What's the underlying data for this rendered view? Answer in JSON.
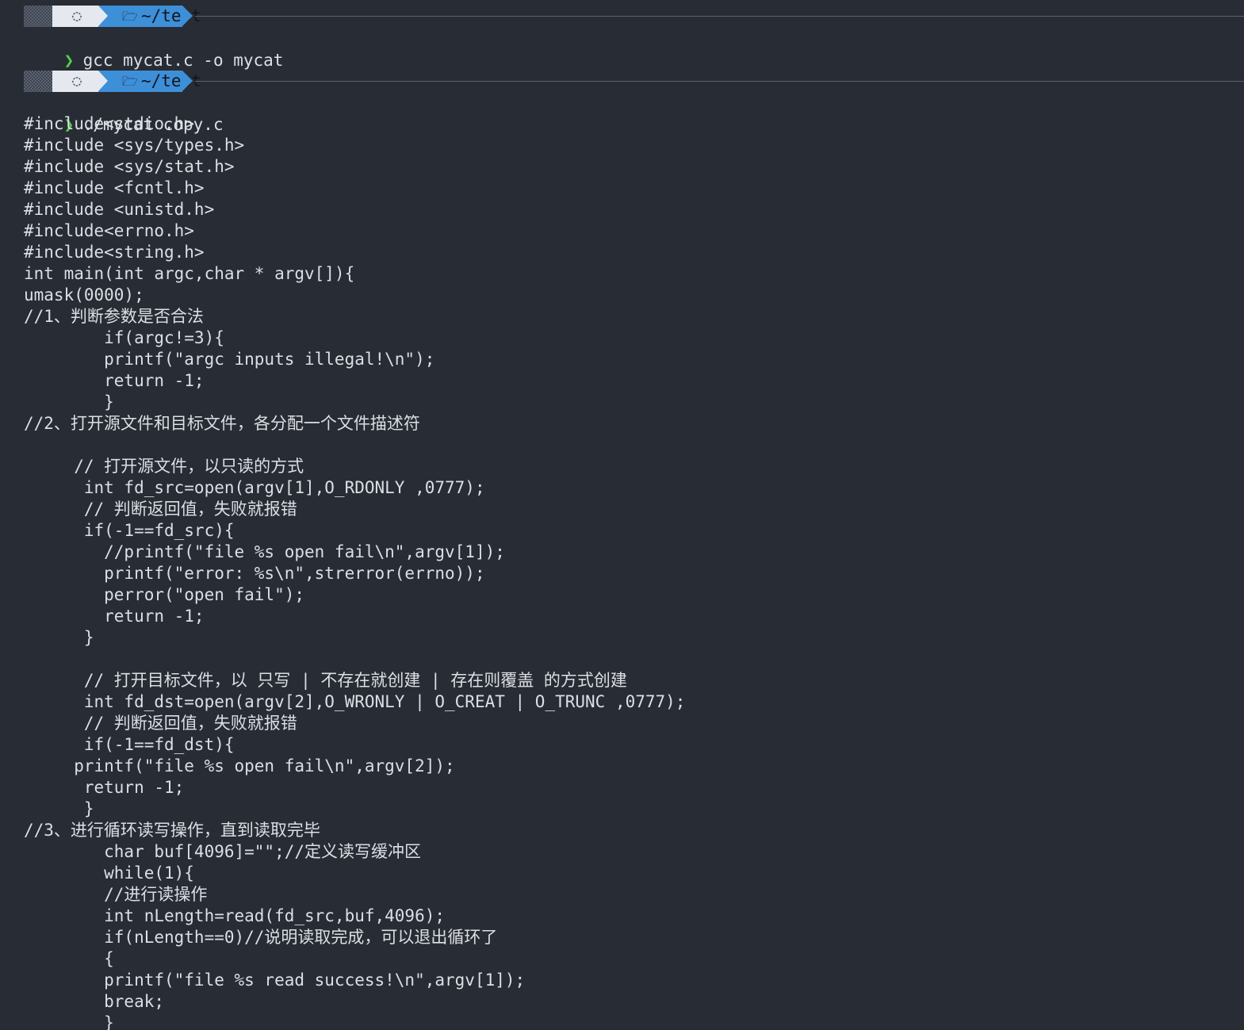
{
  "window": {
    "background": "#282c34",
    "foreground": "#dcdfe4"
  },
  "prompts": [
    {
      "os_icon": "ubuntu-icon",
      "folder_icon": "folder-icon",
      "directory": "~/test",
      "chevron": "❯",
      "command": "gcc mycat.c -o mycat"
    },
    {
      "os_icon": "ubuntu-icon",
      "folder_icon": "folder-icon",
      "directory": "~/test",
      "chevron": "❯",
      "command": "./mycat copy.c"
    }
  ],
  "colors": {
    "os_segment": "#e5e8ee",
    "dir_segment": "#3d8fd8",
    "chevron": "#4fd14a",
    "rule": "#5c6370"
  },
  "output_lines": [
    "#include<stdio.h>",
    "#include <sys/types.h>",
    "#include <sys/stat.h>",
    "#include <fcntl.h>",
    "#include <unistd.h>",
    "#include<errno.h>",
    "#include<string.h>",
    "int main(int argc,char * argv[]){",
    "umask(0000);",
    "//1、判断参数是否合法",
    "        if(argc!=3){",
    "        printf(\"argc inputs illegal!\\n\");",
    "        return -1;",
    "        }",
    "//2、打开源文件和目标文件，各分配一个文件描述符",
    "",
    "     // 打开源文件，以只读的方式",
    "      int fd_src=open(argv[1],O_RDONLY ,0777);",
    "      // 判断返回值，失败就报错",
    "      if(-1==fd_src){",
    "        //printf(\"file %s open fail\\n\",argv[1]);",
    "        printf(\"error: %s\\n\",strerror(errno));",
    "        perror(\"open fail\");",
    "        return -1;",
    "      }",
    "",
    "      // 打开目标文件，以 只写 | 不存在就创建 | 存在则覆盖 的方式创建",
    "      int fd_dst=open(argv[2],O_WRONLY | O_CREAT | O_TRUNC ,0777);",
    "      // 判断返回值，失败就报错",
    "      if(-1==fd_dst){",
    "     printf(\"file %s open fail\\n\",argv[2]);",
    "      return -1;",
    "      }",
    "//3、进行循环读写操作，直到读取完毕",
    "        char buf[4096]=\"\";//定义读写缓冲区",
    "        while(1){",
    "        //进行读操作",
    "        int nLength=read(fd_src,buf,4096);",
    "        if(nLength==0)//说明读取完成，可以退出循环了",
    "        {",
    "        printf(\"file %s read success!\\n\",argv[1]);",
    "        break;",
    "        }"
  ]
}
